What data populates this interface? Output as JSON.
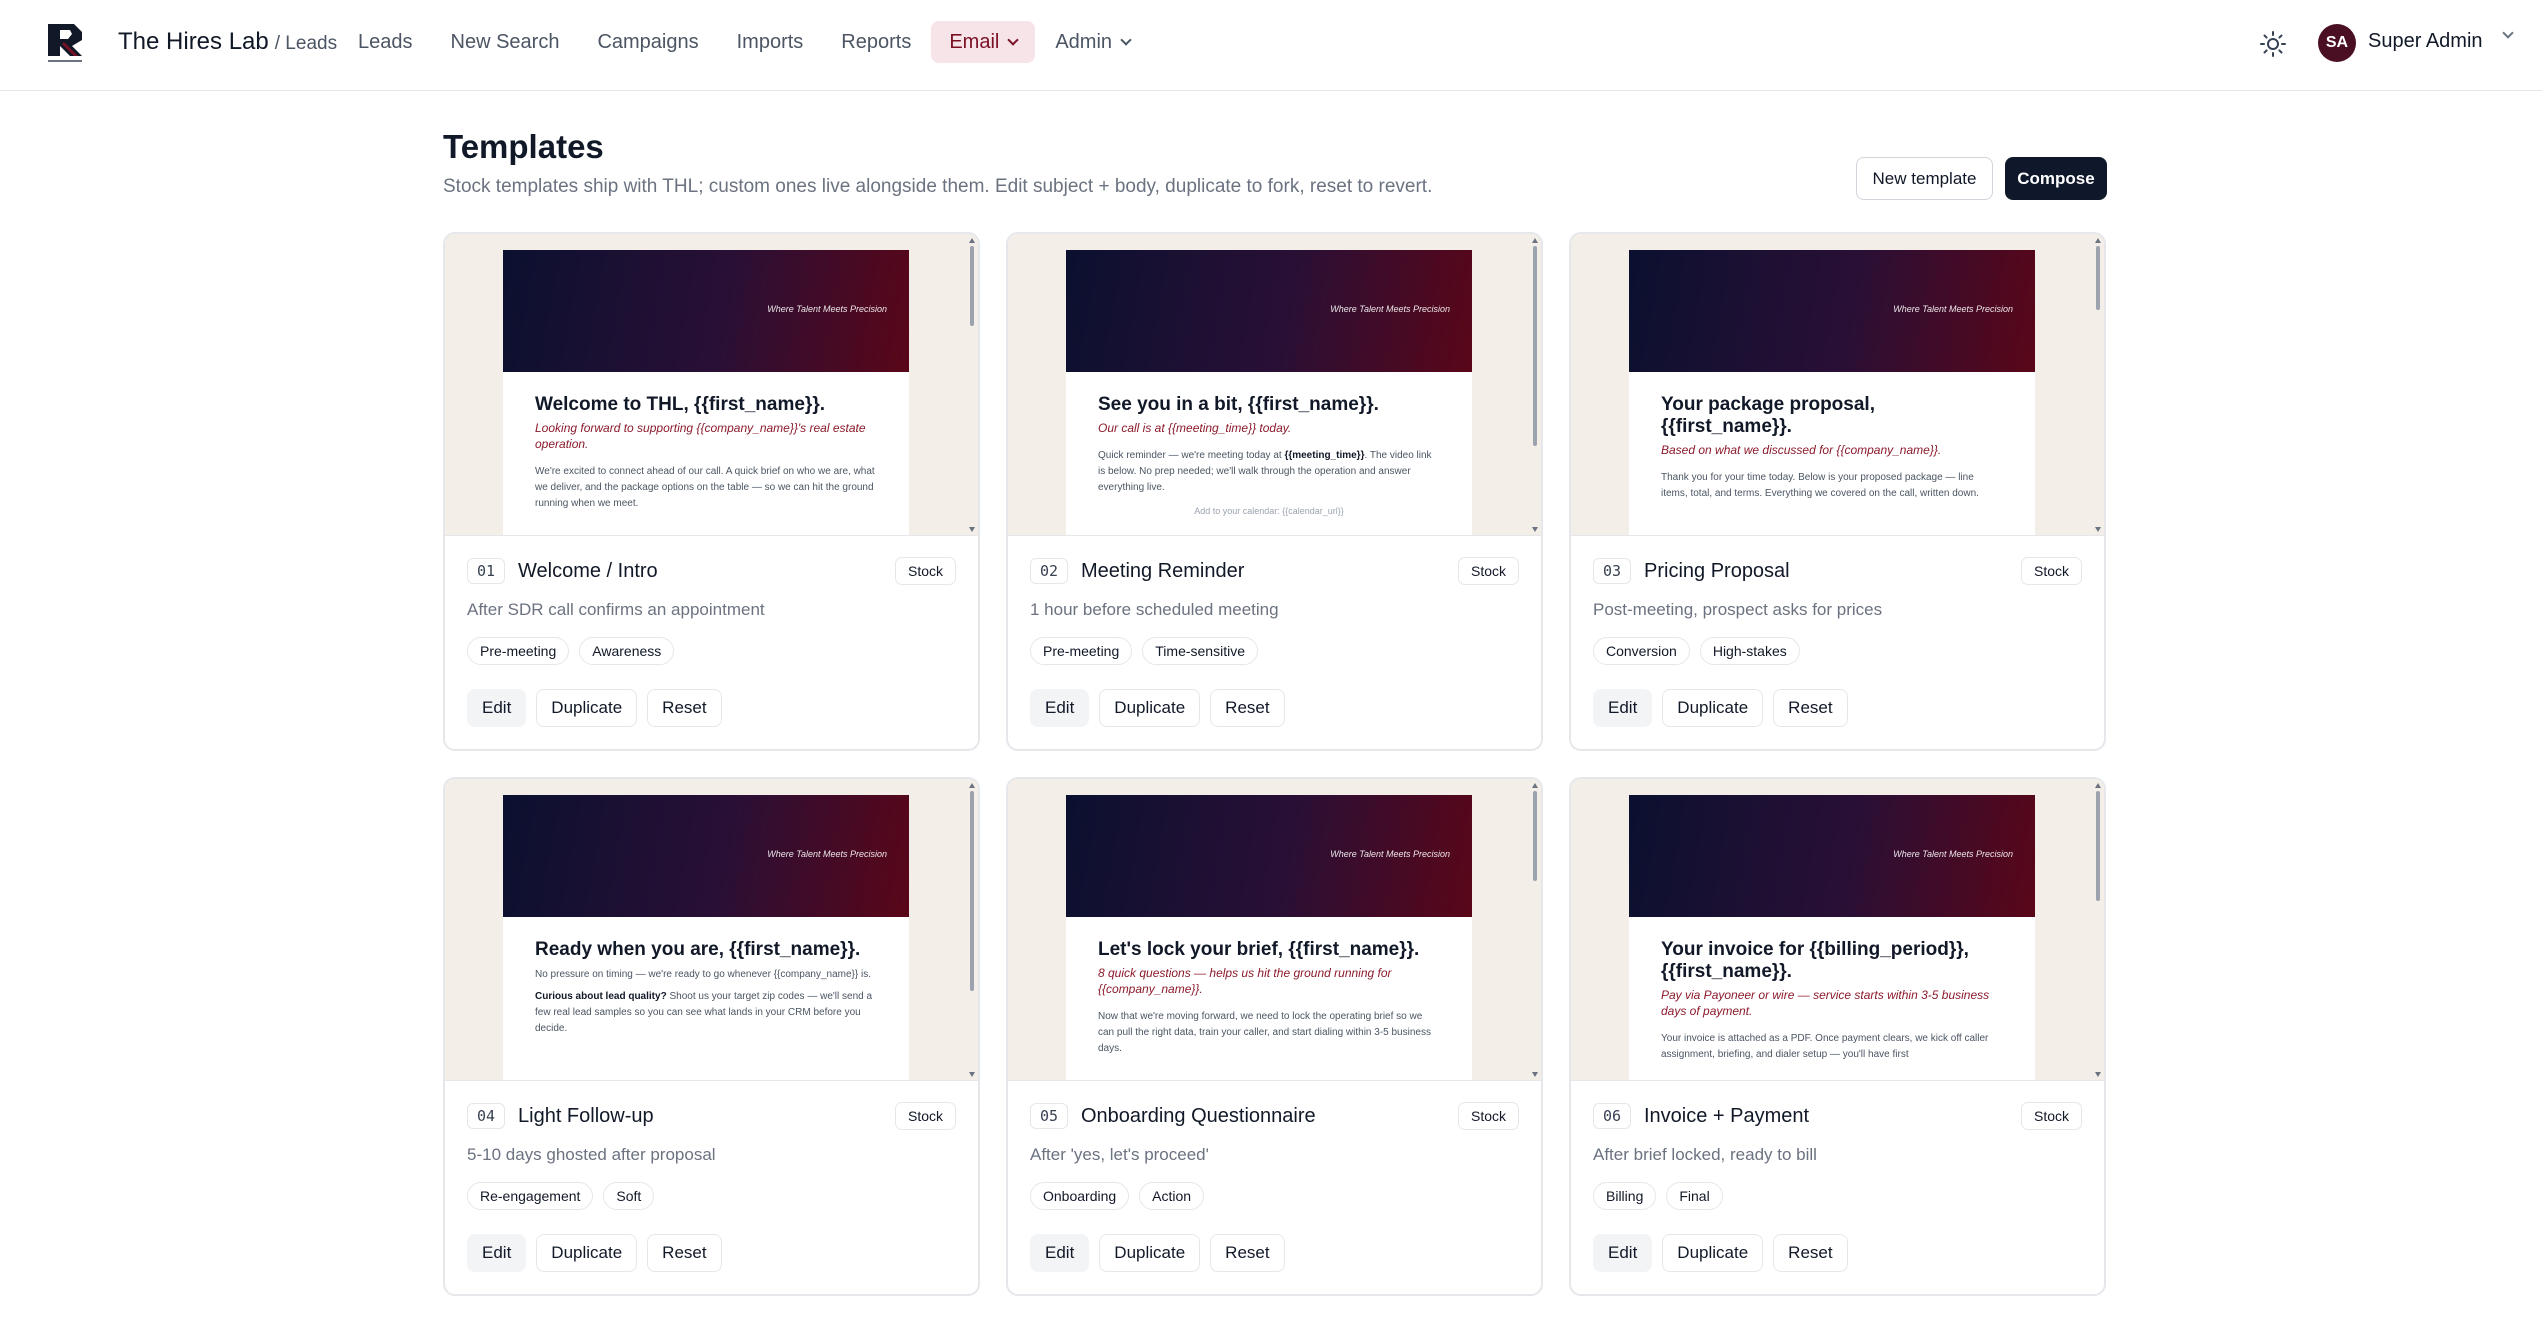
{
  "header": {
    "brand": "The Hires Lab",
    "crumb": "/ Leads",
    "nav": [
      {
        "label": "Leads"
      },
      {
        "label": "New Search"
      },
      {
        "label": "Campaigns"
      },
      {
        "label": "Imports"
      },
      {
        "label": "Reports"
      },
      {
        "label": "Email",
        "active": true,
        "dropdown": true
      },
      {
        "label": "Admin",
        "dropdown": true
      }
    ],
    "theme_icon": "sun-icon",
    "user": {
      "initials": "SA",
      "name": "Super Admin"
    }
  },
  "page": {
    "title": "Templates",
    "subtitle": "Stock templates ship with THL; custom ones live alongside them. Edit subject + body, duplicate to fork, reset to revert.",
    "new_template_label": "New template",
    "compose_label": "Compose"
  },
  "colors": {
    "accent": "#7a1024",
    "primary": "#0f172a",
    "avatar": "#4a0f22"
  },
  "email_tagline": "Where Talent Meets Precision",
  "labels": {
    "stock": "Stock",
    "edit": "Edit",
    "duplicate": "Duplicate",
    "reset": "Reset"
  },
  "templates": [
    {
      "num": "01",
      "title": "Welcome / Intro",
      "desc": "After SDR call confirms an appointment",
      "tags": [
        "Pre-meeting",
        "Awareness"
      ],
      "preview": {
        "headline": "Welcome to THL, {{first_name}}.",
        "sub": "Looking forward to supporting {{company_name}}'s real estate operation.",
        "text": "We're excited to connect ahead of our call. A quick brief on who we are, what we deliver, and the package options on the table — so we can hit the ground running when we meet."
      }
    },
    {
      "num": "02",
      "title": "Meeting Reminder",
      "desc": "1 hour before scheduled meeting",
      "tags": [
        "Pre-meeting",
        "Time-sensitive"
      ],
      "preview": {
        "headline": "See you in a bit, {{first_name}}.",
        "sub": "Our call is at {{meeting_time}} today.",
        "text_pre": "Quick reminder — we're meeting today at ",
        "text_bold": "{{meeting_time}}",
        "text_post": ". The video link is below. No prep needed; we'll walk through the operation and answer everything live.",
        "foot": "Add to your calendar: {{calendar_url}}"
      }
    },
    {
      "num": "03",
      "title": "Pricing Proposal",
      "desc": "Post-meeting, prospect asks for prices",
      "tags": [
        "Conversion",
        "High-stakes"
      ],
      "preview": {
        "headline": "Your package proposal, {{first_name}}.",
        "sub": "Based on what we discussed for {{company_name}}.",
        "text": "Thank you for your time today. Below is your proposed package — line items, total, and terms. Everything we covered on the call, written down."
      }
    },
    {
      "num": "04",
      "title": "Light Follow-up",
      "desc": "5-10 days ghosted after proposal",
      "tags": [
        "Re-engagement",
        "Soft"
      ],
      "preview": {
        "headline": "Ready when you are, {{first_name}}.",
        "text": "No pressure on timing — we're ready to go whenever {{company_name}} is.",
        "text2_bold": "Curious about lead quality?",
        "text2": " Shoot us your target zip codes — we'll send a few real lead samples so you can see what lands in your CRM before you decide."
      }
    },
    {
      "num": "05",
      "title": "Onboarding Questionnaire",
      "desc": "After 'yes, let's proceed'",
      "tags": [
        "Onboarding",
        "Action"
      ],
      "preview": {
        "headline": "Let's lock your brief, {{first_name}}.",
        "sub": "8 quick questions — helps us hit the ground running for {{company_name}}.",
        "text": "Now that we're moving forward, we need to lock the operating brief so we can pull the right data, train your caller, and start dialing within 3-5 business days."
      }
    },
    {
      "num": "06",
      "title": "Invoice + Payment",
      "desc": "After brief locked, ready to bill",
      "tags": [
        "Billing",
        "Final"
      ],
      "preview": {
        "headline": "Your invoice for {{billing_period}}, {{first_name}}.",
        "sub": "Pay via Payoneer or wire — service starts within 3-5 business days of payment.",
        "text": "Your invoice is attached as a PDF. Once payment clears, we kick off caller assignment, briefing, and dialer setup — you'll have first"
      }
    }
  ]
}
